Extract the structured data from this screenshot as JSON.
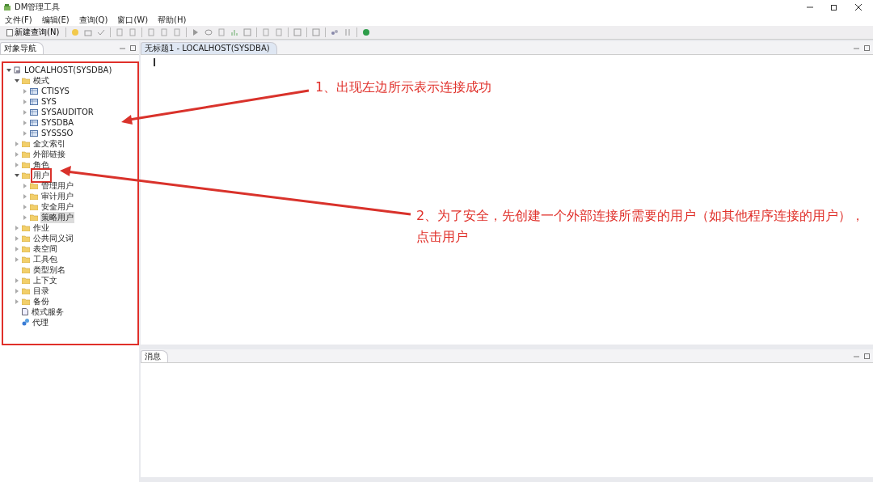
{
  "window": {
    "title": "DM管理工具"
  },
  "menu": [
    "文件(F)",
    "编辑(E)",
    "查询(Q)",
    "窗口(W)",
    "帮助(H)"
  ],
  "toolbar": {
    "new_query": "新建查询(N)"
  },
  "navigator": {
    "title": "对象导航",
    "tree": [
      {
        "label": "LOCALHOST(SYSDBA)",
        "kind": "server",
        "expanded": true,
        "selected": false,
        "highlighted": false,
        "children": [
          {
            "label": "模式",
            "kind": "folder",
            "expanded": true,
            "selected": false,
            "highlighted": false,
            "children": [
              {
                "label": "CTISYS",
                "kind": "schema",
                "expanded": false,
                "selected": false,
                "highlighted": false
              },
              {
                "label": "SYS",
                "kind": "schema",
                "expanded": false,
                "selected": false,
                "highlighted": false
              },
              {
                "label": "SYSAUDITOR",
                "kind": "schema",
                "expanded": false,
                "selected": false,
                "highlighted": false
              },
              {
                "label": "SYSDBA",
                "kind": "schema",
                "expanded": false,
                "selected": false,
                "highlighted": false
              },
              {
                "label": "SYSSSO",
                "kind": "schema",
                "expanded": false,
                "selected": false,
                "highlighted": false
              }
            ]
          },
          {
            "label": "全文索引",
            "kind": "folder",
            "expanded": false,
            "selected": false,
            "highlighted": false
          },
          {
            "label": "外部链接",
            "kind": "folder",
            "expanded": false,
            "selected": false,
            "highlighted": false
          },
          {
            "label": "角色",
            "kind": "folder",
            "expanded": false,
            "selected": false,
            "highlighted": false
          },
          {
            "label": "用户",
            "kind": "folder",
            "expanded": true,
            "selected": false,
            "highlighted": true,
            "children": [
              {
                "label": "管理用户",
                "kind": "folder",
                "expanded": false,
                "selected": false,
                "highlighted": false
              },
              {
                "label": "审计用户",
                "kind": "folder",
                "expanded": false,
                "selected": false,
                "highlighted": false
              },
              {
                "label": "安全用户",
                "kind": "folder",
                "expanded": false,
                "selected": false,
                "highlighted": false
              },
              {
                "label": "策略用户",
                "kind": "folder",
                "expanded": false,
                "selected": true,
                "highlighted": false
              }
            ]
          },
          {
            "label": "作业",
            "kind": "folder",
            "expanded": false,
            "selected": false,
            "highlighted": false
          },
          {
            "label": "公共同义词",
            "kind": "folder",
            "expanded": false,
            "selected": false,
            "highlighted": false
          },
          {
            "label": "表空间",
            "kind": "folder",
            "expanded": false,
            "selected": false,
            "highlighted": false
          },
          {
            "label": "工具包",
            "kind": "folder",
            "expanded": false,
            "selected": false,
            "highlighted": false
          },
          {
            "label": "类型别名",
            "kind": "folder",
            "selected": false,
            "highlighted": false
          },
          {
            "label": "上下文",
            "kind": "folder",
            "expanded": false,
            "selected": false,
            "highlighted": false
          },
          {
            "label": "目录",
            "kind": "folder",
            "expanded": false,
            "selected": false,
            "highlighted": false
          },
          {
            "label": "备份",
            "kind": "folder",
            "expanded": false,
            "selected": false,
            "highlighted": false
          },
          {
            "label": "模式服务",
            "kind": "document",
            "selected": false,
            "highlighted": false
          },
          {
            "label": "代理",
            "kind": "agent",
            "selected": false,
            "highlighted": false
          }
        ]
      }
    ]
  },
  "editor": {
    "tab": "无标题1 - LOCALHOST(SYSDBA)"
  },
  "messages": {
    "title": "消息"
  },
  "annotations": [
    {
      "text": "1、出现左边所示表示连接成功"
    },
    {
      "text": "2、为了安全，先创建一个外部连接所需要的用户（如其他程序连接的用户），点击用户"
    }
  ]
}
